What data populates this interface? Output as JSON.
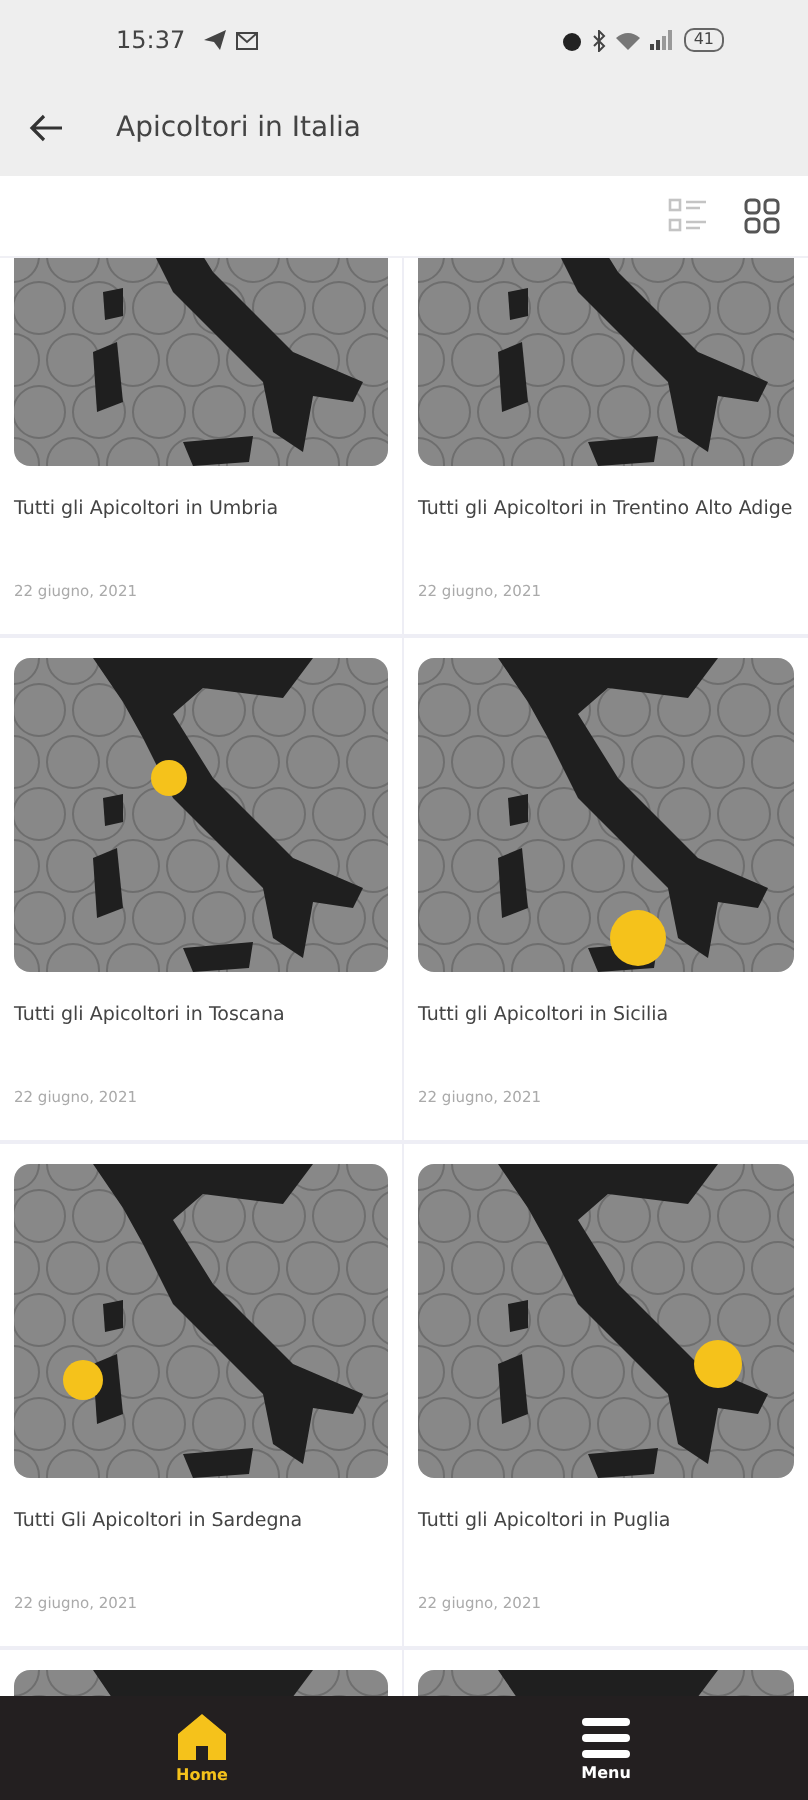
{
  "status_bar": {
    "time": "15:37",
    "battery": "41"
  },
  "app_bar": {
    "title": "Apicoltori in Italia"
  },
  "view_toggle": [
    {
      "kind": "list",
      "selected": false
    },
    {
      "kind": "grid",
      "selected": true
    }
  ],
  "cards": [
    {
      "image": {
        "kind": "picture"
      },
      "title": "Tutti gli Apicoltori in Umbria",
      "date": "22 giugno, 2021"
    },
    {
      "image": {
        "kind": "picture"
      },
      "title": "Tutti gli Apicoltori in Trentino Alto Adige",
      "date": "22 giugno, 2021"
    },
    {
      "image": {
        "kind": "picture"
      },
      "title": "Tutti gli Apicoltori in Toscana",
      "date": "22 giugno, 2021"
    },
    {
      "image": {
        "kind": "picture"
      },
      "title": "Tutti gli Apicoltori in Sicilia",
      "date": "22 giugno, 2021"
    },
    {
      "image": {
        "kind": "picture"
      },
      "title": "Tutti Gli Apicoltori in Sardegna",
      "date": "22 giugno, 2021"
    },
    {
      "image": {
        "kind": "picture"
      },
      "title": "Tutti gli Apicoltori in Puglia",
      "date": "22 giugno, 2021"
    },
    {
      "image": {
        "kind": "picture"
      }
    },
    {
      "image": {
        "kind": "picture"
      }
    }
  ],
  "bottom_nav": [
    {
      "kind": "home",
      "label": "Home",
      "selected": true
    },
    {
      "kind": "menu",
      "label": "Menu",
      "selected": false
    }
  ]
}
